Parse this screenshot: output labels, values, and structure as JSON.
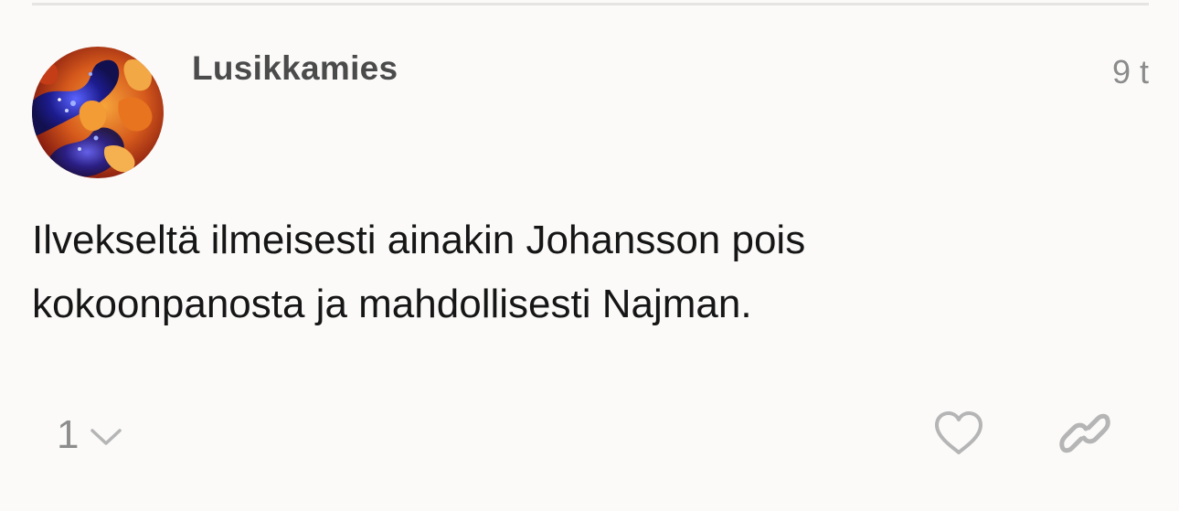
{
  "post": {
    "username": "Lusikkamies",
    "timestamp": "9 t",
    "body_line_1": "Ilvekseltä ilmeisesti ainakin Johansson pois",
    "body_line_2": "kokoonpanosta ja mahdollisesti Najman.",
    "reply_count": "1"
  },
  "icons": {
    "expand": "chevron-down-icon",
    "like": "heart-icon",
    "share": "link-icon"
  },
  "colors": {
    "background": "#fbfaf9",
    "username": "#4b4b4b",
    "muted": "#8b8b8b",
    "icon": "#b5b5b5"
  }
}
